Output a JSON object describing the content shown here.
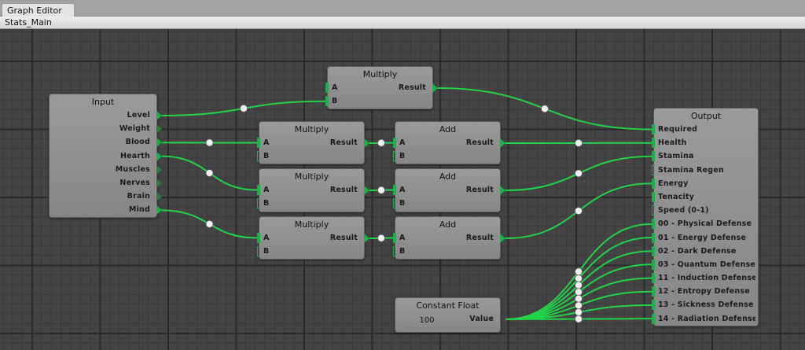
{
  "window": {
    "tab": "Graph Editor",
    "breadcrumb": "Stats_Main"
  },
  "colors": {
    "wire": "#22d34a",
    "port": "#19b24a"
  },
  "nodes": {
    "input": {
      "title": "Input",
      "outputs": [
        "Level",
        "Weight",
        "Blood",
        "Hearth",
        "Muscles",
        "Nerves",
        "Brain",
        "Mind"
      ],
      "connected": [
        true,
        false,
        true,
        true,
        false,
        false,
        false,
        true
      ]
    },
    "mult0": {
      "title": "Multiply",
      "inputs": [
        "A",
        "B"
      ],
      "output": "Result"
    },
    "mult1": {
      "title": "Multiply",
      "inputs": [
        "A",
        "B"
      ],
      "output": "Result"
    },
    "mult2": {
      "title": "Multiply",
      "inputs": [
        "A",
        "B"
      ],
      "output": "Result"
    },
    "mult3": {
      "title": "Multiply",
      "inputs": [
        "A",
        "B"
      ],
      "output": "Result"
    },
    "add1": {
      "title": "Add",
      "inputs": [
        "A",
        "B"
      ],
      "output": "Result"
    },
    "add2": {
      "title": "Add",
      "inputs": [
        "A",
        "B"
      ],
      "output": "Result"
    },
    "add3": {
      "title": "Add",
      "inputs": [
        "A",
        "B"
      ],
      "output": "Result"
    },
    "const": {
      "title": "Constant Float",
      "value": "100",
      "output": "Value"
    },
    "output": {
      "title": "Output",
      "inputs": [
        "Required",
        "Health",
        "Stamina",
        "Stamina Regen",
        "Energy",
        "Tenacity",
        "Speed (0-1)",
        "00 - Physical Defense",
        "01 - Energy Defense",
        "02 - Dark Defense",
        "03 - Quantum Defense",
        "11 - Induction Defense",
        "12 - Entropy Defense",
        "13 - Sickness Defense",
        "14 - Radiation Defense"
      ],
      "connected": [
        true,
        true,
        true,
        false,
        true,
        true,
        false,
        true,
        true,
        true,
        true,
        true,
        true,
        true,
        true
      ]
    }
  },
  "connections": [
    [
      "input-0",
      "mult0-B"
    ],
    [
      "mult0-out",
      "output-0"
    ],
    [
      "input-2",
      "mult1-A"
    ],
    [
      "input-3",
      "mult2-A"
    ],
    [
      "input-7",
      "mult3-A"
    ],
    [
      "mult1-out",
      "add1-A"
    ],
    [
      "mult2-out",
      "add2-A"
    ],
    [
      "mult3-out",
      "add3-A"
    ],
    [
      "add1-out",
      "output-1"
    ],
    [
      "add2-out",
      "output-2"
    ],
    [
      "add3-out",
      "output-4"
    ],
    [
      "const-out",
      "output-7"
    ],
    [
      "const-out",
      "output-8"
    ],
    [
      "const-out",
      "output-9"
    ],
    [
      "const-out",
      "output-10"
    ],
    [
      "const-out",
      "output-11"
    ],
    [
      "const-out",
      "output-12"
    ],
    [
      "const-out",
      "output-13"
    ],
    [
      "const-out",
      "output-14"
    ]
  ]
}
